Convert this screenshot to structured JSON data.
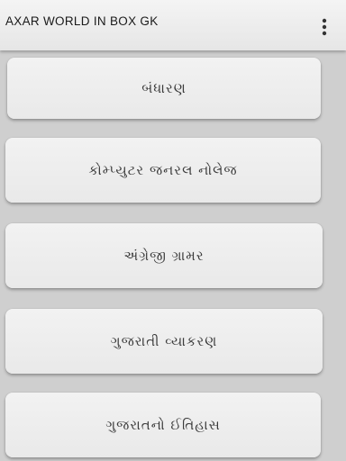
{
  "app_bar": {
    "title": "AXAR WORLD IN BOX GK",
    "overflow_icon": "more-vert-icon"
  },
  "menu": {
    "items": [
      {
        "label": "બંધારણ"
      },
      {
        "label": "કોમ્પ્યુટર જનરલ નોલેજ"
      },
      {
        "label": "અંગ્રેજી ગ્રામર"
      },
      {
        "label": "ગુજરાતી વ્યાકરણ"
      },
      {
        "label": "ગુજરાતનો ઈતિહાસ"
      }
    ]
  }
}
